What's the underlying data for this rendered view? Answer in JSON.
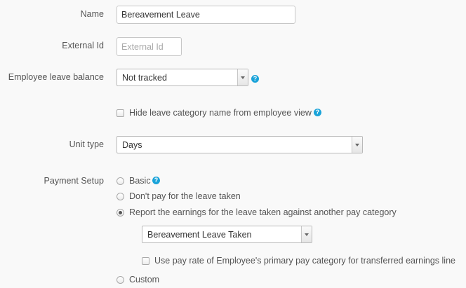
{
  "fields": {
    "name": {
      "label": "Name",
      "value": "Bereavement Leave"
    },
    "external_id": {
      "label": "External Id",
      "placeholder": "External Id"
    },
    "leave_balance": {
      "label": "Employee leave balance",
      "value": "Not tracked"
    },
    "hide_category": {
      "label": "Hide leave category name from employee view",
      "checked": false
    },
    "unit_type": {
      "label": "Unit type",
      "value": "Days"
    }
  },
  "payment_setup": {
    "label": "Payment Setup",
    "options": [
      {
        "label": "Basic",
        "selected": false
      },
      {
        "label": "Don't pay for the leave taken",
        "selected": false
      },
      {
        "label": "Report the earnings for the leave taken against another pay category",
        "selected": true
      },
      {
        "label": "Custom",
        "selected": false
      }
    ],
    "pay_category": {
      "value": "Bereavement Leave Taken"
    },
    "use_primary_rate": {
      "label": "Use pay rate of Employee's primary pay category for transferred earnings line",
      "checked": false
    }
  },
  "help_icon_glyph": "?",
  "accent_color": "#1aa3d9"
}
